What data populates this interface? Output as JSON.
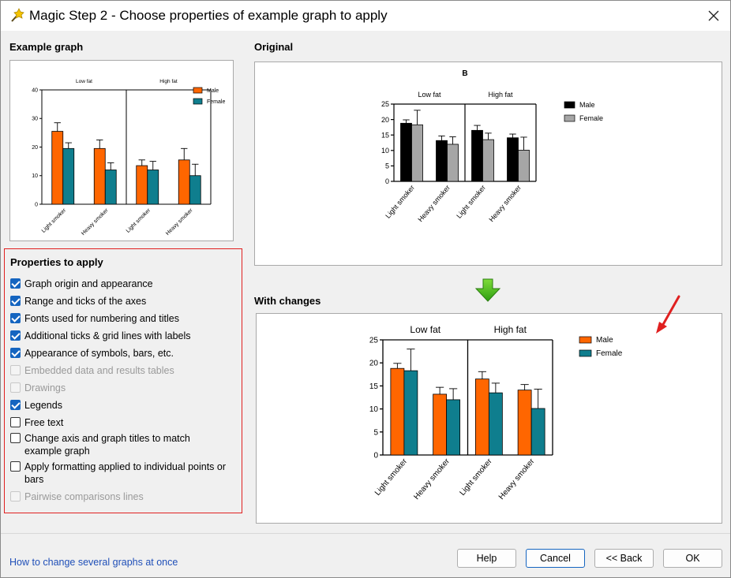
{
  "window": {
    "title": "Magic Step 2 - Choose properties of example graph to apply"
  },
  "sections": {
    "example_graph": "Example graph",
    "original": "Original",
    "with_changes": "With changes"
  },
  "properties": {
    "title": "Properties to apply",
    "items": [
      {
        "label": "Graph origin and appearance",
        "checked": true,
        "enabled": true
      },
      {
        "label": "Range and ticks of the axes",
        "checked": true,
        "enabled": true
      },
      {
        "label": "Fonts used for numbering and titles",
        "checked": true,
        "enabled": true
      },
      {
        "label": "Additional ticks & grid lines with labels",
        "checked": true,
        "enabled": true
      },
      {
        "label": "Appearance of symbols, bars, etc.",
        "checked": true,
        "enabled": true
      },
      {
        "label": "Embedded data and results tables",
        "checked": false,
        "enabled": false
      },
      {
        "label": "Drawings",
        "checked": false,
        "enabled": false
      },
      {
        "label": "Legends",
        "checked": true,
        "enabled": true
      },
      {
        "label": "Free text",
        "checked": false,
        "enabled": true
      },
      {
        "label": "Change axis and graph titles to match example graph",
        "checked": false,
        "enabled": true
      },
      {
        "label": "Apply formatting applied to individual points or bars",
        "checked": false,
        "enabled": true
      },
      {
        "label": "Pairwise comparisons lines",
        "checked": false,
        "enabled": false
      }
    ]
  },
  "footer": {
    "link": "How to change several graphs at once",
    "help": "Help",
    "cancel": "Cancel",
    "back": "<< Back",
    "ok": "OK"
  },
  "icons": {
    "app": "magic-wand-icon",
    "close": "close-icon",
    "arrow_down": "green-down-arrow-icon",
    "annotation": "red-arrow-icon"
  },
  "colors": {
    "male_orange": "#ff6600",
    "female_teal": "#0f7e8e",
    "male_black": "#000000",
    "female_gray": "#a6a6a6",
    "checkbox_blue": "#1565c0",
    "highlight_red": "#e02020",
    "link_blue": "#1f4fb8"
  },
  "chart_data": [
    {
      "type": "bar",
      "role": "example",
      "title": "",
      "groups": [
        "Low fat",
        "High fat"
      ],
      "categories": [
        "Light smoker",
        "Heavy smoker",
        "Light smoker",
        "Heavy smoker"
      ],
      "series": [
        {
          "name": "Male",
          "color": "#ff6600",
          "values": [
            25.5,
            19.5,
            13.5,
            15.5
          ],
          "errors": [
            3,
            3,
            2,
            4
          ]
        },
        {
          "name": "Female",
          "color": "#0f7e8e",
          "values": [
            19.5,
            12,
            12,
            10
          ],
          "errors": [
            2,
            2.5,
            3,
            4
          ]
        }
      ],
      "ylim": [
        0,
        40
      ],
      "yticks": [
        "0",
        "10",
        "20",
        "30",
        "40"
      ],
      "legend": "top-right"
    },
    {
      "type": "bar",
      "role": "original",
      "title": "B",
      "groups": [
        "Low fat",
        "High fat"
      ],
      "categories": [
        "Light smoker",
        "Heavy smoker",
        "Light smoker",
        "Heavy smoker"
      ],
      "series": [
        {
          "name": "Male",
          "color": "#000000",
          "values": [
            18.8,
            13.2,
            16.5,
            14.1
          ],
          "errors": [
            1.1,
            1.5,
            1.6,
            1.2
          ]
        },
        {
          "name": "Female",
          "color": "#a6a6a6",
          "values": [
            18.3,
            12,
            13.5,
            10.1
          ],
          "errors": [
            4.7,
            2.4,
            2.1,
            4.2
          ]
        }
      ],
      "ylim": [
        0,
        25
      ],
      "yticks": [
        "0",
        "5",
        "10",
        "15",
        "20",
        "25"
      ],
      "legend": "top-right"
    },
    {
      "type": "bar",
      "role": "with_changes",
      "title": "",
      "groups": [
        "Low fat",
        "High fat"
      ],
      "categories": [
        "Light smoker",
        "Heavy smoker",
        "Light smoker",
        "Heavy smoker"
      ],
      "series": [
        {
          "name": "Male",
          "color": "#ff6600",
          "values": [
            18.8,
            13.2,
            16.5,
            14.1
          ],
          "errors": [
            1.1,
            1.5,
            1.6,
            1.2
          ]
        },
        {
          "name": "Female",
          "color": "#0f7e8e",
          "values": [
            18.3,
            12,
            13.5,
            10.1
          ],
          "errors": [
            4.7,
            2.4,
            2.1,
            4.2
          ]
        }
      ],
      "ylim": [
        0,
        25
      ],
      "yticks": [
        "0",
        "5",
        "10",
        "15",
        "20",
        "25"
      ],
      "legend": "top-right"
    }
  ]
}
